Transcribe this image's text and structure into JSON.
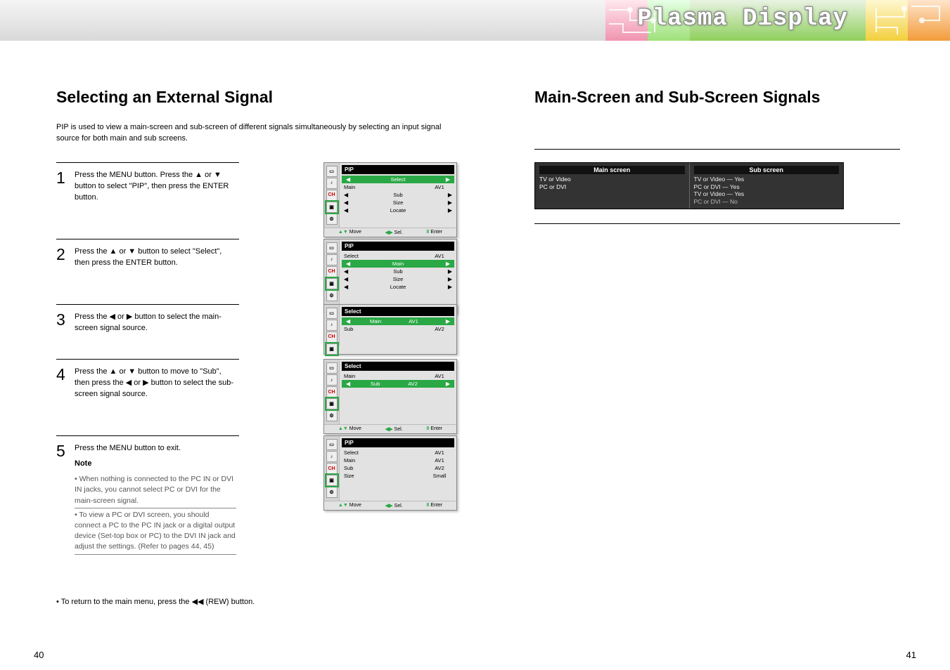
{
  "banner": {
    "title": "Plasma Display"
  },
  "left": {
    "title": "Selecting an External Signal",
    "intro": "PIP is used to view a main-screen and sub-screen of different signals simultaneously by selecting an input signal source for both main and sub screens.",
    "steps": [
      {
        "num": "1",
        "body": "Press the MENU button.\nPress the ▲ or ▼ button to select \"PIP\", then press the ENTER button.",
        "hi": false
      },
      {
        "num": "2",
        "body": "Press the ▲ or ▼ button to select \"Select\", then press the ENTER button.",
        "hi": true
      },
      {
        "num": "3",
        "body": "Press the ◀ or ▶ button to select the main-screen signal source.",
        "hi": false
      },
      {
        "num": "4",
        "body": "Press the ▲ or ▼ button to move to \"Sub\", then press the ◀ or ▶ button to select the sub-screen signal source.",
        "hi": false
      },
      {
        "num": "5",
        "body": "Press the MENU button to exit.",
        "note_label": "Note",
        "notes": [
          "• When nothing is connected to the PC IN or DVI IN jacks, you cannot select PC or DVI for the main-screen signal.",
          "• To view a PC or DVI screen, you should connect a PC to the PC IN jack or a digital output device (Set-top box or PC) to the DVI IN jack and adjust the settings. (Refer to pages 44, 45)"
        ]
      }
    ],
    "outro": "• To return to the main menu, press the ◀◀ (REW) button.",
    "pagenum": "40",
    "osd": {
      "title": "PIP",
      "rows": [
        {
          "label": "Select",
          "val": "AV1"
        },
        {
          "label": "Main",
          "val": "AV1"
        },
        {
          "label": "Sub",
          "val": "AV2"
        },
        {
          "label": "Size",
          "val": "Small"
        },
        {
          "label": "Locate",
          "val": ""
        }
      ],
      "sel_title": "Select",
      "sel_rows": [
        {
          "label": "Main",
          "val": "AV1"
        },
        {
          "label": "Sub",
          "val": "AV2"
        }
      ],
      "help": [
        {
          "sym": "▲▼",
          "txt": "Move"
        },
        {
          "sym": "◀▶",
          "txt": "Sel."
        },
        {
          "sym": "II",
          "txt": "Enter"
        }
      ],
      "help_alt": [
        {
          "sym": "▲▼",
          "txt": "Move"
        },
        {
          "sym": "II",
          "txt": "Enter"
        }
      ]
    }
  },
  "right": {
    "title": "Main-Screen and Sub-Screen Signals",
    "pip": {
      "main_hdr": "Main screen",
      "sub_hdr": "Sub screen",
      "rows": [
        [
          "TV or Video",
          "TV or Video"
        ],
        [
          "",
          "PC or DVI"
        ],
        [
          "PC or DVI",
          "TV or Video"
        ],
        [
          "",
          "PC or DVI"
        ]
      ],
      "flags": [
        "Yes",
        "Yes",
        "Yes",
        "No"
      ]
    },
    "pagenum": "41"
  }
}
